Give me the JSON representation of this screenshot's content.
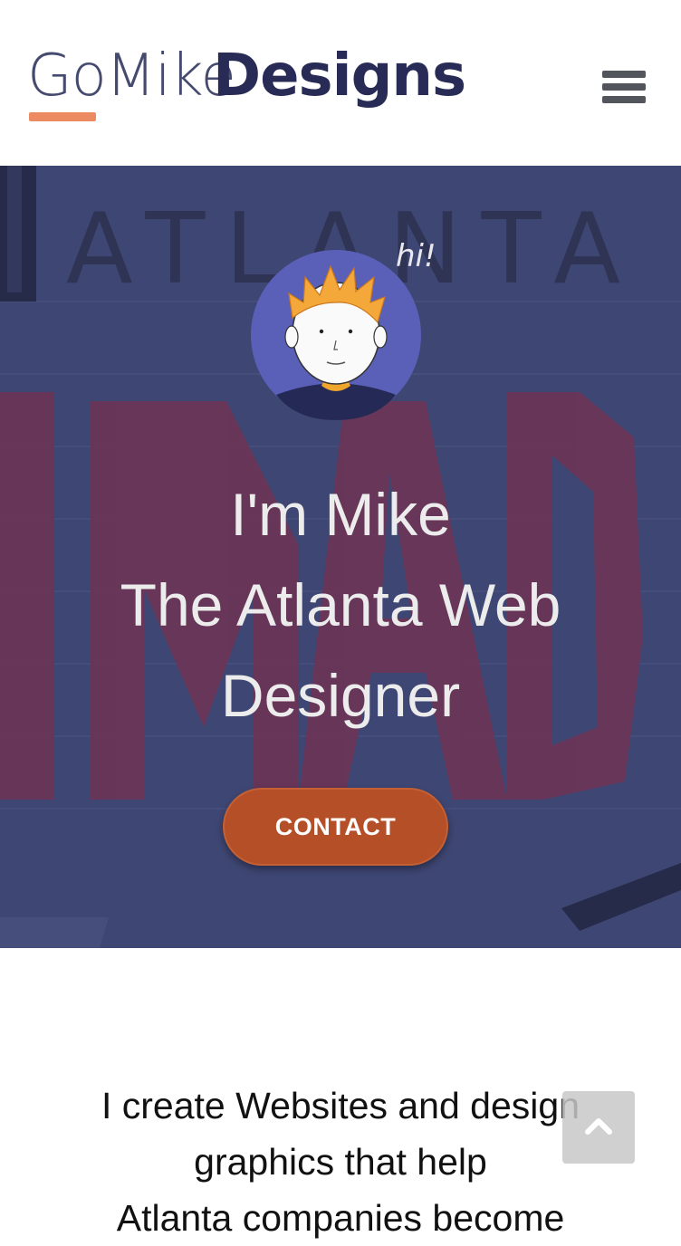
{
  "header": {
    "logo": {
      "part1": "GoMike",
      "part2": "Designs"
    },
    "menu_icon": "hamburger-menu-icon"
  },
  "hero": {
    "background_sign_text": "ATLANTA",
    "bubble_text": "hi!",
    "headline_line1": "I'm Mike",
    "headline_line2": "The Atlanta Web",
    "headline_line3": "Designer",
    "contact_label": "CONTACT",
    "colors": {
      "overlay": "#3e4673",
      "button": "#b44f27"
    }
  },
  "intro": {
    "line1": "I create Websites and design",
    "line2": "graphics that help",
    "line3": "Atlanta companies become"
  },
  "scroll_top_icon": "chevron-up-icon"
}
